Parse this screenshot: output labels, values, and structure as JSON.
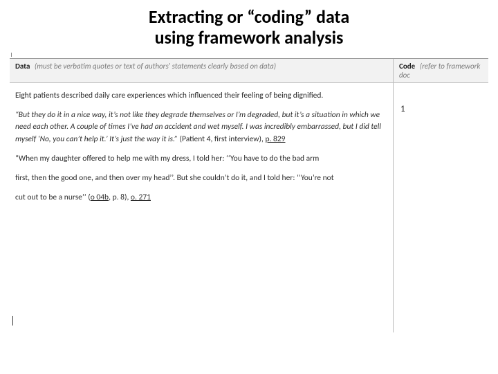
{
  "title_line1": "Extracting or “coding” data",
  "title_line2": "using framework analysis",
  "header": {
    "data_label": "Data",
    "data_desc": "(must be verbatim quotes or text of authors' statements clearly based on data)",
    "code_label": "Code",
    "code_desc": "(refer to framework doc"
  },
  "cell": {
    "para1": "Eight patients described daily care experiences which influenced their feeling of being dignified.",
    "q1_a": "“But they do it in a nice way, it’s not like they degrade themselves or I’m degraded, but it’s a situation in which we need each other. A couple of times I’ve had an accident and wet myself. I was incredibly embarrassed, but I did tell myself ‘No, you can’t help it.’ It’s just the way it is.”",
    "q1_b": " (Patient 4, first interview), ",
    "q1_c": "p. 829",
    "q2_a": "“When my daughter offered to help me with my dress, I told her: ‘‘You have to do the bad arm",
    "q2_line2": "first, then the good one, and then over my head’’. But she couldn’t do it, and I told her: ‘‘You’re not",
    "q2_tail_a": "cut out to be a nurse’’ (",
    "q2_tail_b": "o 04b",
    "q2_tail_c": ", p. 8), ",
    "q2_tail_d": "o. 271"
  },
  "code_value": "1"
}
